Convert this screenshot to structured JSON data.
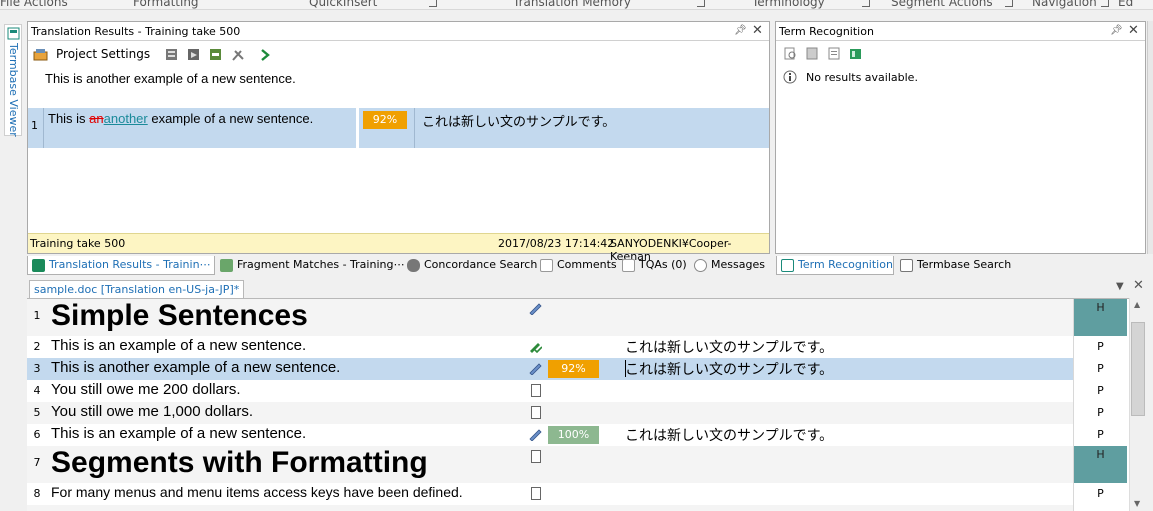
{
  "ribbon": {
    "groups": [
      "File Actions",
      "Formatting",
      "QuickInsert",
      "Translation Memory",
      "Terminology",
      "Segment Actions",
      "Navigation",
      "Ed"
    ]
  },
  "left_tab": {
    "label": "Termbase Viewer"
  },
  "tr_panel": {
    "title": "Translation Results - Training take 500",
    "toolbar": {
      "project_settings": "Project Settings"
    },
    "source_text": "This is another example of a new sentence.",
    "result": {
      "index": "1",
      "src_prefix": "This is ",
      "src_deleted": "an",
      "src_inserted": "another",
      "src_suffix": " example of a new sentence.",
      "match": "92%",
      "target": "これは新しい文のサンプルです。"
    },
    "status": {
      "tm_name": "Training take 500",
      "timestamp": "2017/08/23 17:14:42",
      "user": "SANYODENKI¥Cooper-Keenan"
    }
  },
  "term_panel": {
    "title": "Term Recognition",
    "message": "No results available."
  },
  "tabs": {
    "translation_results": "Translation Results - Trainin⋯",
    "fragment_matches": "Fragment Matches - Training⋯",
    "concordance": "Concordance Search",
    "comments": "Comments",
    "tqas": "TQAs (0)",
    "messages": "Messages",
    "term_recognition": "Term Recognition",
    "termbase_search": "Termbase Search"
  },
  "editor": {
    "doc_tab": "sample.doc [Translation en-US-ja-JP]*",
    "rows": [
      {
        "n": "1",
        "source": "Simple Sentences",
        "match": "",
        "target": "",
        "status": "H"
      },
      {
        "n": "2",
        "source": "This is an example of a new sentence.",
        "match": "",
        "target": "これは新しい文のサンプルです。",
        "status": "P"
      },
      {
        "n": "3",
        "source": "This is another example of a new sentence.",
        "match": "92%",
        "target": "これは新しい文のサンプルです。",
        "status": "P"
      },
      {
        "n": "4",
        "source": "You still owe me 200 dollars.",
        "match": "",
        "target": "",
        "status": "P"
      },
      {
        "n": "5",
        "source": "You still owe me 1,000 dollars.",
        "match": "",
        "target": "",
        "status": "P"
      },
      {
        "n": "6",
        "source": "This is an example of a new sentence.",
        "match": "100%",
        "target": "これは新しい文のサンプルです。",
        "status": "P"
      },
      {
        "n": "7",
        "source": "Segments with Formatting",
        "match": "",
        "target": "",
        "status": "H"
      },
      {
        "n": "8",
        "source": "For many menus and menu items access keys have been defined.",
        "match": "",
        "target": "",
        "status": "P"
      }
    ]
  },
  "colors": {
    "match_orange": "#f0a000",
    "match_green": "#8db890",
    "status_teal": "#5f9ea0",
    "selected_row": "#c3d9ee",
    "status_bar": "#fdf5c3",
    "link_teal": "#1a8a9a",
    "deleted_red": "#e00000"
  }
}
